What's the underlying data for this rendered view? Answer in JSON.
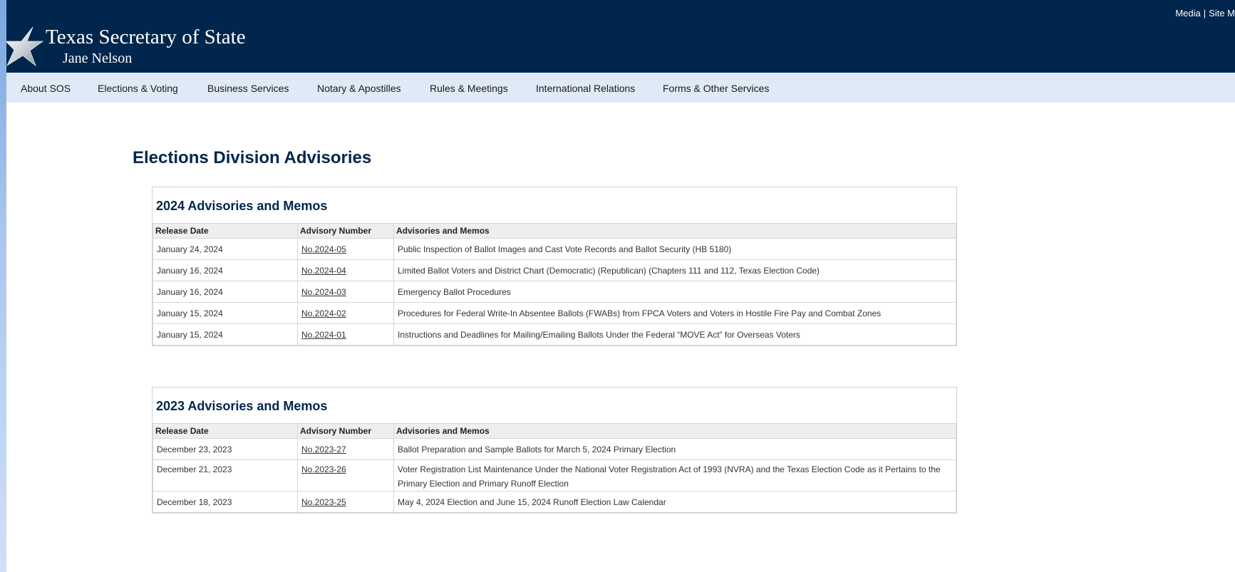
{
  "header": {
    "top_links": [
      "Media",
      "Site M"
    ],
    "top_link_separator": "|",
    "title": "Texas Secretary of State",
    "subtitle": "Jane Nelson",
    "logo_icon": "star-logo-icon",
    "colors": {
      "header_bg": "#00264d",
      "nav_bg": "#dfeaf6"
    }
  },
  "nav": {
    "items": [
      "About SOS",
      "Elections & Voting",
      "Business Services",
      "Notary & Apostilles",
      "Rules & Meetings",
      "International Relations",
      "Forms & Other Services"
    ]
  },
  "main": {
    "page_title": "Elections Division Advisories",
    "sections": [
      {
        "title": "2024 Advisories and Memos",
        "columns": [
          "Release Date",
          "Advisory Number",
          "Advisories and Memos"
        ],
        "rows": [
          {
            "date": "January 24, 2024",
            "number": "No.2024-05",
            "desc": "Public Inspection of Ballot Images and Cast Vote Records and Ballot Security (HB 5180)"
          },
          {
            "date": "January 16, 2024",
            "number": "No.2024-04",
            "desc": "Limited Ballot Voters and District Chart (Democratic) (Republican) (Chapters 111 and 112, Texas Election Code)"
          },
          {
            "date": "January 16, 2024",
            "number": "No.2024-03",
            "desc": "Emergency Ballot Procedures"
          },
          {
            "date": "January 15, 2024",
            "number": "No.2024-02",
            "desc": "Procedures for Federal Write-In Absentee Ballots (FWABs) from FPCA Voters and Voters in Hostile Fire Pay and Combat Zones"
          },
          {
            "date": "January 15, 2024",
            "number": "No.2024-01",
            "desc": "Instructions and Deadlines for Mailing/Emailing Ballots Under the Federal “MOVE Act” for Overseas Voters"
          }
        ]
      },
      {
        "title": "2023 Advisories and Memos",
        "columns": [
          "Release Date",
          "Advisory Number",
          "Advisories and Memos"
        ],
        "rows": [
          {
            "date": "December 23, 2023",
            "number": "No.2023-27",
            "desc": "Ballot Preparation and Sample Ballots for March 5, 2024 Primary Election"
          },
          {
            "date": "December 21, 2023",
            "number": "No.2023-26",
            "desc": "Voter Registration List Maintenance Under the National Voter Registration Act of 1993 (NVRA) and the Texas Election Code as it Pertains to the Primary Election and Primary Runoff Election"
          },
          {
            "date": "December 18, 2023",
            "number": "No.2023-25",
            "desc": "May 4, 2024 Election and June 15, 2024 Runoff Election Law Calendar"
          }
        ]
      }
    ]
  }
}
